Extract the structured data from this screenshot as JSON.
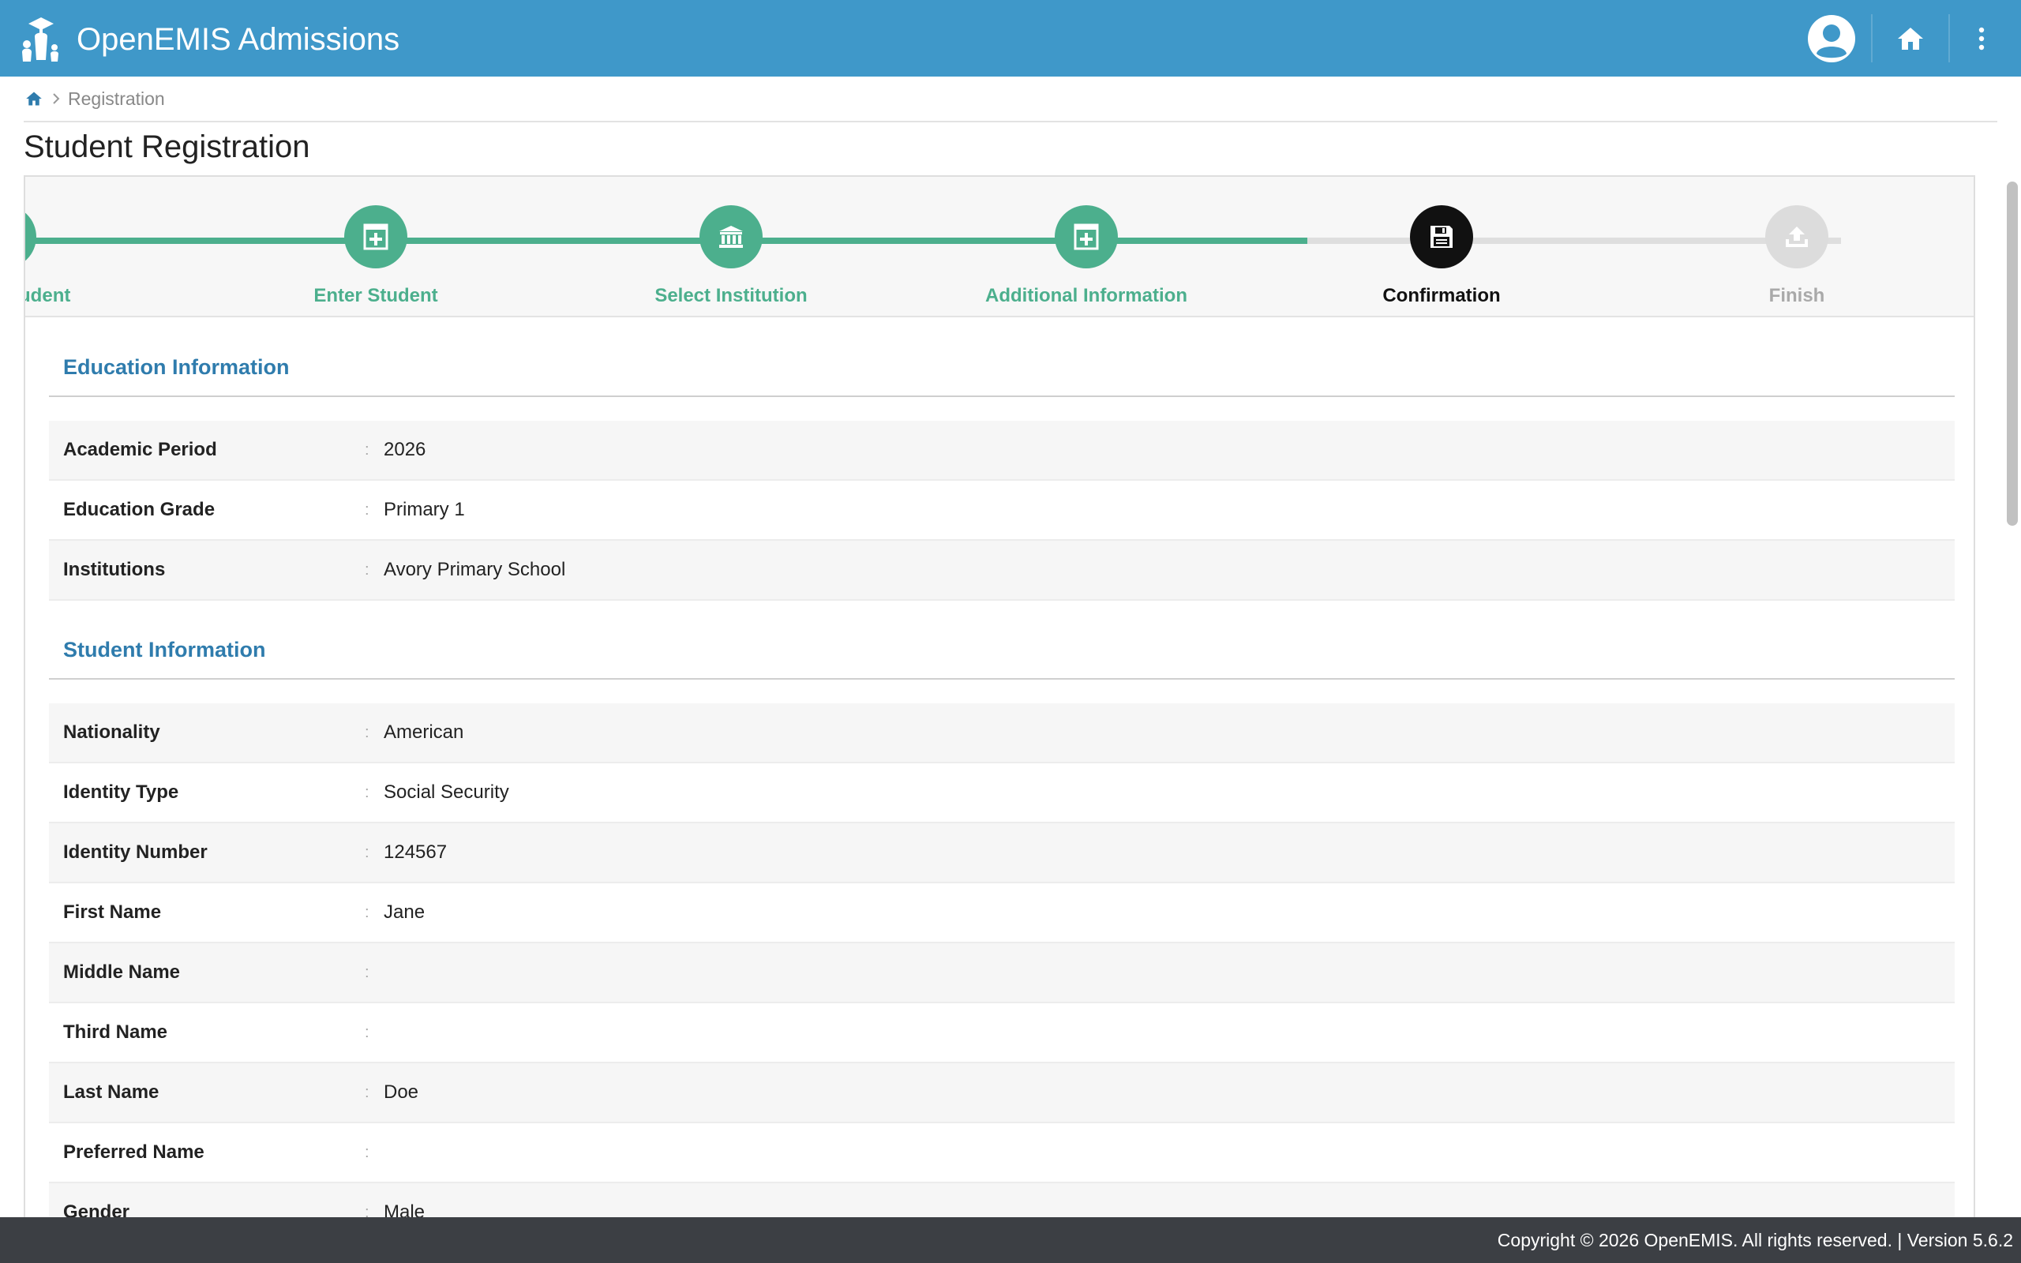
{
  "header": {
    "app_title": "OpenEMIS Admissions",
    "brand_color": "#3f98c9",
    "icons": [
      "openemis-logo-icon",
      "user-avatar-icon",
      "home-icon",
      "more-vertical-icon"
    ]
  },
  "breadcrumb": {
    "home_icon": "home-icon",
    "current": "Registration"
  },
  "page": {
    "title": "Student Registration"
  },
  "wizard": {
    "steps": [
      {
        "label": "Select Student",
        "icon": "graduation-cap-icon",
        "state": "complete"
      },
      {
        "label": "Enter Student",
        "icon": "plus-square-icon",
        "state": "complete"
      },
      {
        "label": "Select Institution",
        "icon": "institution-icon",
        "state": "complete"
      },
      {
        "label": "Additional Information",
        "icon": "plus-square-icon",
        "state": "complete"
      },
      {
        "label": "Confirmation",
        "icon": "save-icon",
        "state": "active"
      },
      {
        "label": "Finish",
        "icon": "upload-icon",
        "state": "pending"
      }
    ],
    "colors": {
      "complete": "#4caf8d",
      "active": "#111111",
      "pending": "#dcdcdc"
    }
  },
  "sections": {
    "education": {
      "title": "Education Information",
      "rows": [
        {
          "label": "Academic Period",
          "value": "2026"
        },
        {
          "label": "Education Grade",
          "value": "Primary 1"
        },
        {
          "label": "Institutions",
          "value": "Avory Primary School"
        }
      ]
    },
    "student": {
      "title": "Student Information",
      "rows": [
        {
          "label": "Nationality",
          "value": "American"
        },
        {
          "label": "Identity Type",
          "value": "Social Security"
        },
        {
          "label": "Identity Number",
          "value": "124567"
        },
        {
          "label": "First Name",
          "value": "Jane"
        },
        {
          "label": "Middle Name",
          "value": ""
        },
        {
          "label": "Third Name",
          "value": ""
        },
        {
          "label": "Last Name",
          "value": "Doe"
        },
        {
          "label": "Preferred Name",
          "value": ""
        },
        {
          "label": "Gender",
          "value": "Male"
        }
      ]
    }
  },
  "separator": ":",
  "footer": {
    "text": "Copyright © 2026 OpenEMIS. All rights reserved. | Version 5.6.2"
  }
}
